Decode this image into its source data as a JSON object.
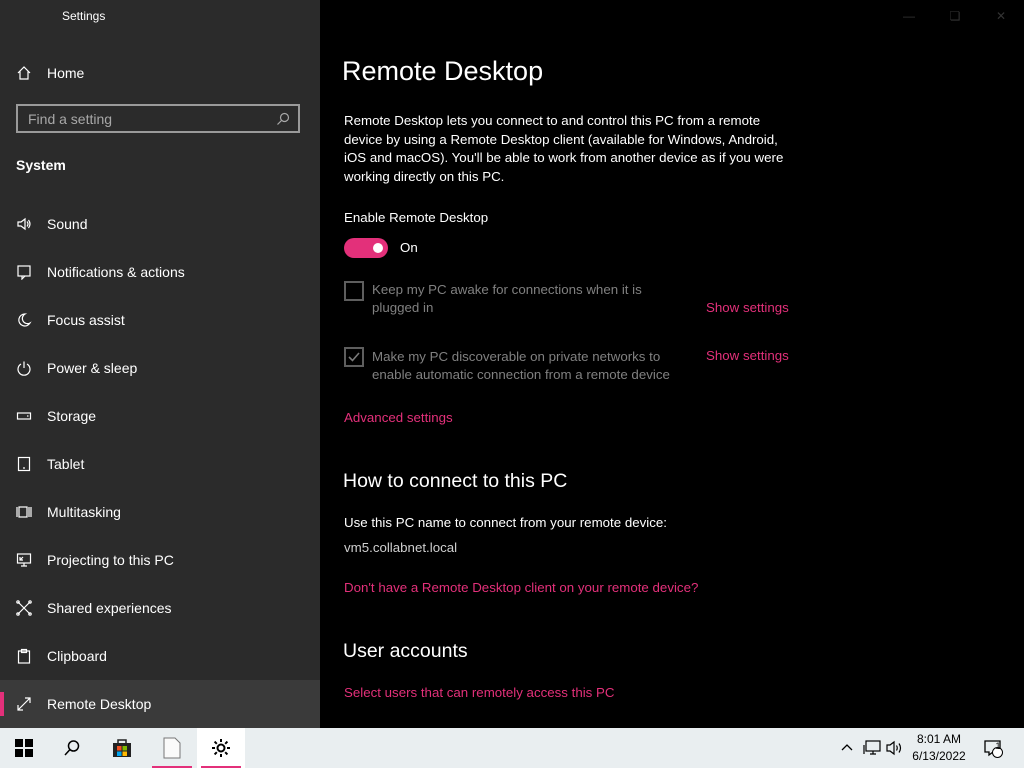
{
  "window": {
    "title": "Settings"
  },
  "sidebar": {
    "home_label": "Home",
    "search_placeholder": "Find a setting",
    "section_label": "System",
    "items": [
      {
        "label": "Sound",
        "icon": "speaker-icon"
      },
      {
        "label": "Notifications & actions",
        "icon": "notification-icon"
      },
      {
        "label": "Focus assist",
        "icon": "moon-icon"
      },
      {
        "label": "Power & sleep",
        "icon": "power-icon"
      },
      {
        "label": "Storage",
        "icon": "storage-icon"
      },
      {
        "label": "Tablet",
        "icon": "tablet-icon"
      },
      {
        "label": "Multitasking",
        "icon": "multitasking-icon"
      },
      {
        "label": "Projecting to this PC",
        "icon": "projecting-icon"
      },
      {
        "label": "Shared experiences",
        "icon": "shared-icon"
      },
      {
        "label": "Clipboard",
        "icon": "clipboard-icon"
      },
      {
        "label": "Remote Desktop",
        "icon": "remote-desktop-icon",
        "active": true
      }
    ]
  },
  "main": {
    "title": "Remote Desktop",
    "description": "Remote Desktop lets you connect to and control this PC from a remote device by using a Remote Desktop client (available for Windows, Android, iOS and macOS). You'll be able to work from another device as if you were working directly on this PC.",
    "enable_label": "Enable Remote Desktop",
    "toggle_state": "On",
    "keep_awake": {
      "text": "Keep my PC awake for connections when it is plugged in",
      "checked": false,
      "link": "Show settings"
    },
    "discoverable": {
      "text": "Make my PC discoverable on private networks to enable automatic connection from a remote device",
      "checked": true,
      "link": "Show settings"
    },
    "advanced_link": "Advanced settings",
    "connect_heading": "How to connect to this PC",
    "connect_text": "Use this PC name to connect from your remote device:",
    "pc_name": "vm5.collabnet.local",
    "client_link": "Don't have a Remote Desktop client on your remote device?",
    "accounts_heading": "User accounts",
    "accounts_link": "Select users that can remotely access this PC"
  },
  "taskbar": {
    "time": "8:01 AM",
    "date": "6/13/2022",
    "notification_count": "1"
  },
  "colors": {
    "accent": "#e3307a",
    "sidebar": "#2b2b2b",
    "background": "#000000"
  }
}
